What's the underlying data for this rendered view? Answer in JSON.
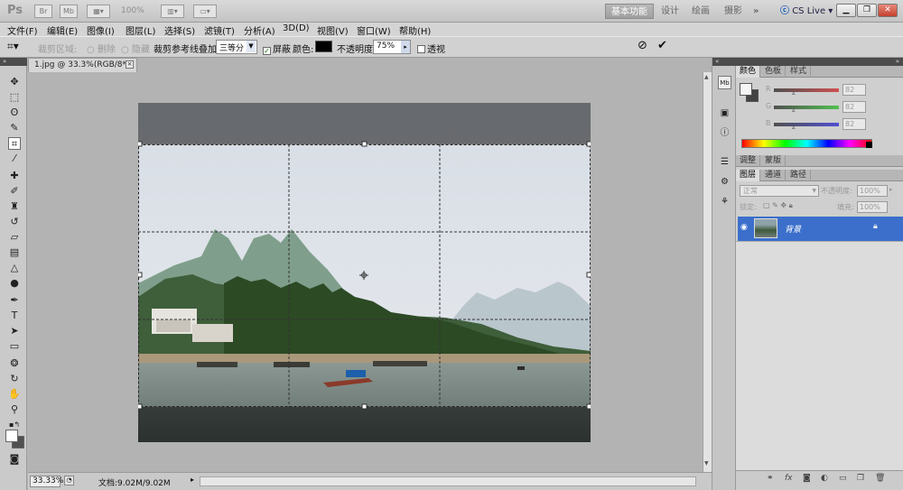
{
  "app": {
    "logo": "Ps",
    "zoom": "100%",
    "workspaces": [
      "基本功能",
      "设计",
      "绘画",
      "摄影"
    ],
    "more": "»",
    "cslive": "CS Live"
  },
  "menu": [
    "文件(F)",
    "编辑(E)",
    "图像(I)",
    "图层(L)",
    "选择(S)",
    "滤镜(T)",
    "分析(A)",
    "3D(D)",
    "视图(V)",
    "窗口(W)",
    "帮助(H)"
  ],
  "options": {
    "crop_area_label": "裁剪区域:",
    "delete_label": "删除",
    "hide_label": "隐藏",
    "overlay_label": "裁剪参考线叠加:",
    "overlay_value": "三等分",
    "shield_label": "屏蔽",
    "color_label": "颜色:",
    "opacity_label": "不透明度:",
    "opacity_value": "75%",
    "perspective_label": "透视",
    "shield_checked": true,
    "shield_color": "#000000"
  },
  "document": {
    "tab_title": "1.jpg @ 33.3%(RGB/8*)",
    "zoom_status": "33.33%",
    "doc_info": "文档:9.02M/9.02M"
  },
  "panels": {
    "color_tabs": [
      "颜色",
      "色板",
      "样式"
    ],
    "rgb": [
      {
        "channel": "R",
        "value": "82"
      },
      {
        "channel": "G",
        "value": "82"
      },
      {
        "channel": "B",
        "value": "82"
      }
    ],
    "adjust_tabs": [
      "调整",
      "蒙版"
    ],
    "layer_tabs": [
      "图层",
      "通道",
      "路径"
    ],
    "blend_mode": "正常",
    "opacity_label": "不透明度:",
    "opacity_value": "100%",
    "lock_label": "锁定:",
    "fill_label": "填充:",
    "fill_value": "100%",
    "layer_name": "背景"
  },
  "accent_color": "#3b6fcb"
}
